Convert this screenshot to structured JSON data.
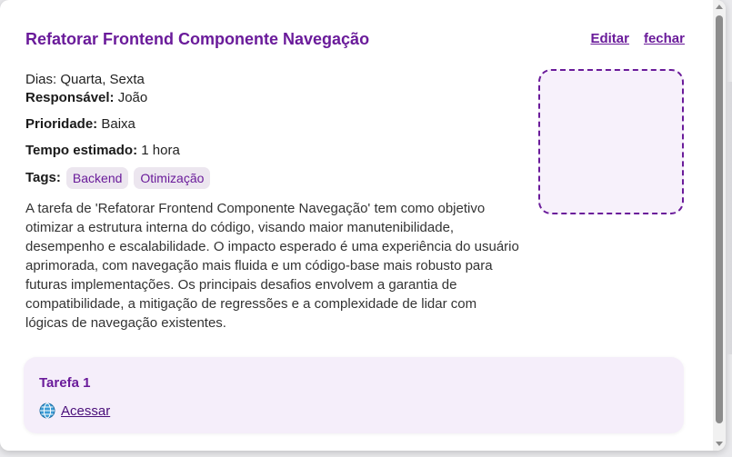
{
  "task": {
    "title": "Refatorar Frontend Componente Navegação",
    "actions": {
      "edit": "Editar",
      "close": "fechar"
    },
    "days": "Dias: Quarta, Sexta",
    "responsible": {
      "label": "Responsável:",
      "value": "João"
    },
    "priority": {
      "label": "Prioridade:",
      "value": "Baixa"
    },
    "estimate": {
      "label": "Tempo estimado:",
      "value": "1 hora"
    },
    "tags": {
      "label": "Tags:",
      "items": [
        "Backend",
        "Otimização"
      ]
    },
    "description": "A tarefa de 'Refatorar Frontend Componente Navegação' tem como objetivo otimizar a estrutura interna do código, visando maior manutenibilidade, desempenho e escalabilidade. O impacto esperado é uma experiência do usuário aprimorada, com navegação mais fluida e um código-base mais robusto para futuras implementações. Os principais desafios envolvem a garantia de compatibilidade, a mitigação de regressões e a complexidade de lidar com lógicas de navegação existentes."
  },
  "subtask": {
    "title": "Tarefa 1",
    "link_label": "Acessar",
    "link_icon": "globe-icon"
  },
  "colors": {
    "accent": "#6a1b9a",
    "tag_bg": "#ece6ef",
    "card_bg": "#f5eefa",
    "placeholder_bg": "#f7f1fb"
  }
}
